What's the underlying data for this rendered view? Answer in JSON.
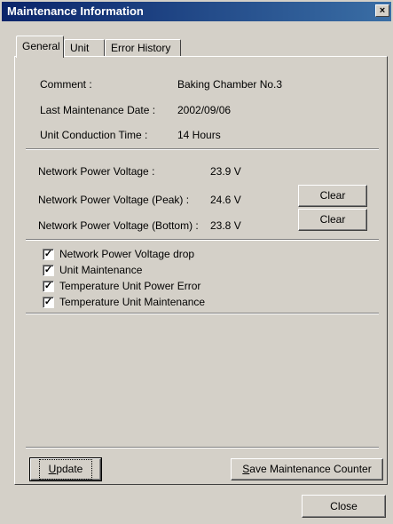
{
  "window": {
    "title": "Maintenance Information",
    "close_glyph": "×"
  },
  "tabs": [
    {
      "label": "General",
      "active": true
    },
    {
      "label": "Unit",
      "active": false
    },
    {
      "label": "Error History",
      "active": false
    }
  ],
  "info": {
    "comment_label": "Comment :",
    "comment_value": "Baking Chamber No.3",
    "date_label": "Last Maintenance Date :",
    "date_value": "2002/09/06",
    "conduction_label": "Unit Conduction Time :",
    "conduction_value": "14 Hours"
  },
  "power": {
    "voltage_label": "Network Power Voltage :",
    "voltage_value": "23.9 V",
    "peak_label": "Network Power Voltage (Peak) :",
    "peak_value": "24.6 V",
    "bottom_label": "Network Power Voltage (Bottom) :",
    "bottom_value": "23.8 V",
    "clear_label": "Clear"
  },
  "checks": [
    {
      "label": "Network Power Voltage drop",
      "checked": true
    },
    {
      "label": "Unit Maintenance",
      "checked": true
    },
    {
      "label": "Temperature Unit Power Error",
      "checked": true
    },
    {
      "label": "Temperature Unit Maintenance",
      "checked": true
    }
  ],
  "check_glyph": "✓",
  "buttons": {
    "update_first": "U",
    "update_rest": "pdate",
    "save_first": "S",
    "save_rest": "ave Maintenance Counter",
    "close": "Close"
  }
}
